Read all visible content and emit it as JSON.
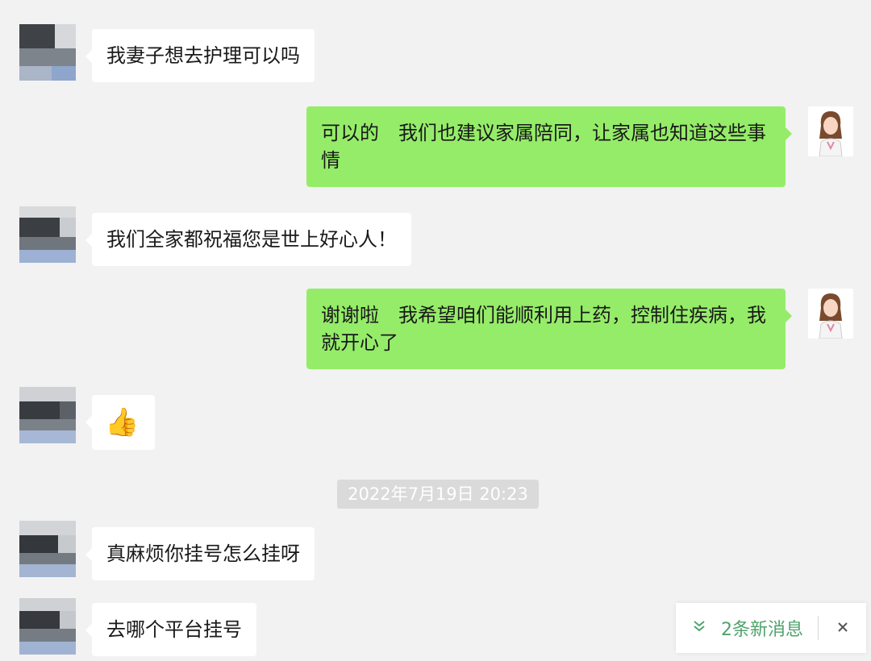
{
  "messages": {
    "m1": {
      "text": "我妻子想去护理可以吗"
    },
    "m2": {
      "text": "可以的　我们也建议家属陪同，让家属也知道这些事情"
    },
    "m3": {
      "text": "我们全家都祝福您是世上好心人！"
    },
    "m4": {
      "text": "谢谢啦　我希望咱们能顺利用上药，控制住疾病，我就开心了"
    },
    "m5": {
      "emoji": "👍"
    },
    "m6": {
      "text": "真麻烦你挂号怎么挂呀"
    },
    "m7": {
      "text": "去哪个平台挂号"
    }
  },
  "timestamp": "2022年7月19日 20:23",
  "new_messages": {
    "icon": "double-chevron-down-icon",
    "label": "2条新消息",
    "close_icon": "close-icon"
  },
  "colors": {
    "background": "#f2f2f2",
    "incoming_bubble": "#ffffff",
    "outgoing_bubble": "#95ec69",
    "accent": "#4fa36c"
  }
}
